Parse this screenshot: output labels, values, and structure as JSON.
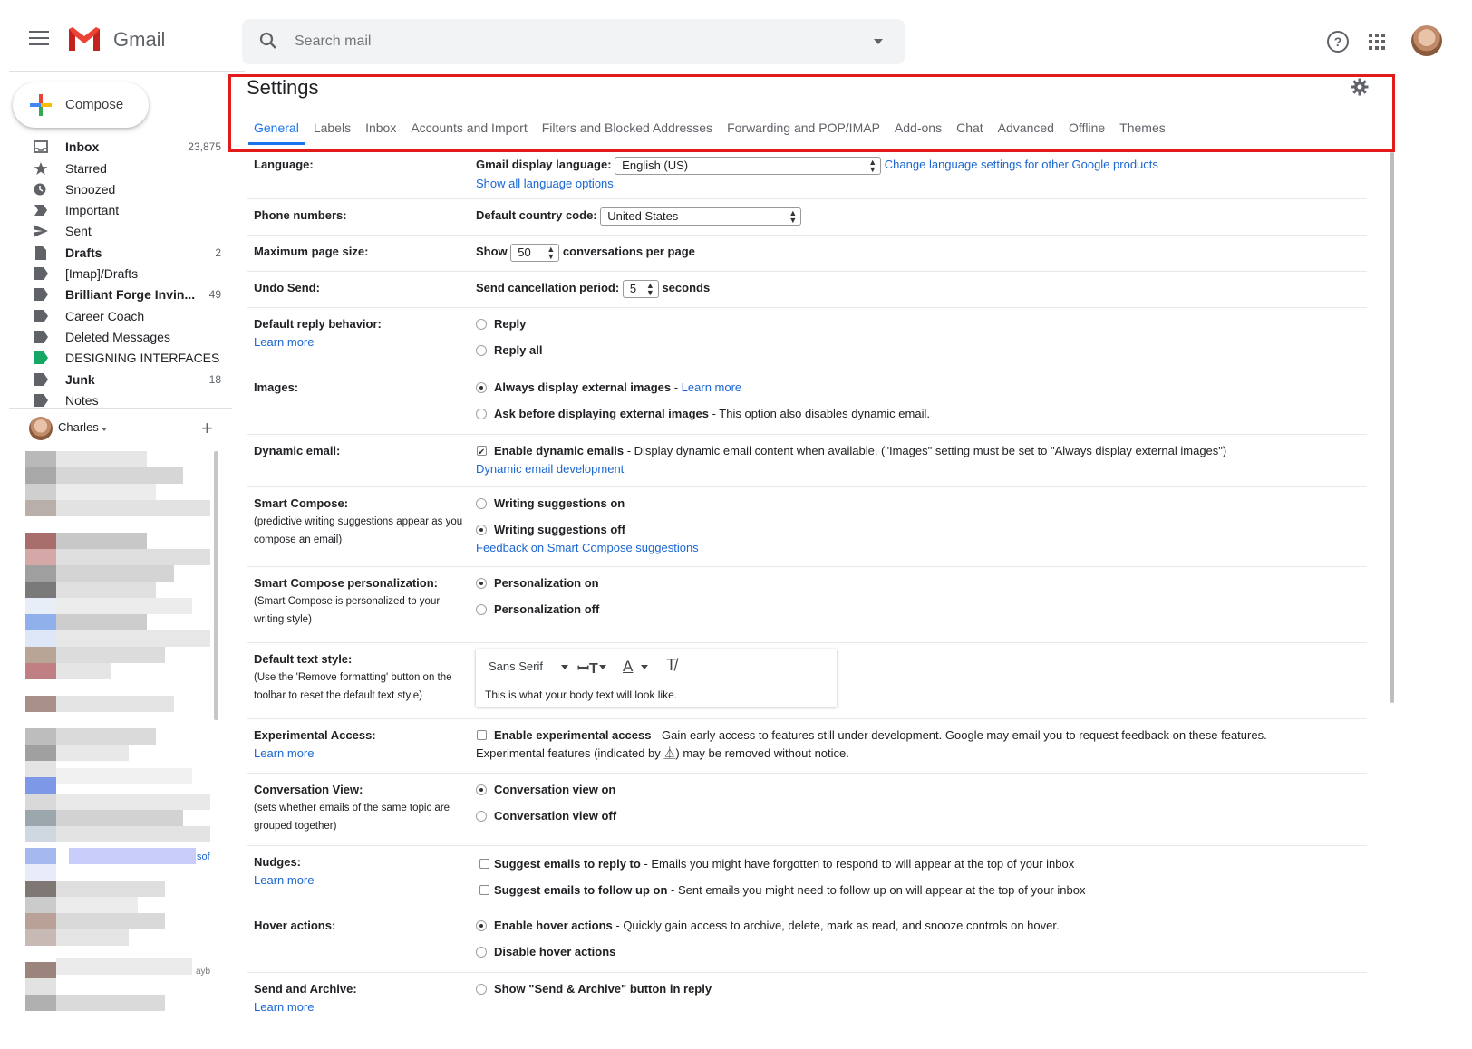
{
  "app": {
    "name": "Gmail"
  },
  "search": {
    "placeholder": "Search mail"
  },
  "compose": {
    "label": "Compose"
  },
  "nav": [
    {
      "label": "Inbox",
      "count": "23,875",
      "bold": true,
      "icon": "inbox-icon"
    },
    {
      "label": "Starred",
      "count": "",
      "bold": false,
      "icon": "star-icon"
    },
    {
      "label": "Snoozed",
      "count": "",
      "bold": false,
      "icon": "clock-icon"
    },
    {
      "label": "Important",
      "count": "",
      "bold": false,
      "icon": "important-icon"
    },
    {
      "label": "Sent",
      "count": "",
      "bold": false,
      "icon": "send-icon"
    },
    {
      "label": "Drafts",
      "count": "2",
      "bold": true,
      "icon": "draft-icon"
    },
    {
      "label": "[Imap]/Drafts",
      "count": "",
      "bold": false,
      "icon": "label-icon"
    },
    {
      "label": "Brilliant Forge Invin...",
      "count": "49",
      "bold": true,
      "icon": "label-icon"
    },
    {
      "label": "Career Coach",
      "count": "",
      "bold": false,
      "icon": "label-icon"
    },
    {
      "label": "Deleted Messages",
      "count": "",
      "bold": false,
      "icon": "label-icon"
    },
    {
      "label": "DESIGNING INTERFACES",
      "count": "",
      "bold": false,
      "icon": "label-green-icon"
    },
    {
      "label": "Junk",
      "count": "18",
      "bold": true,
      "icon": "label-icon"
    },
    {
      "label": "Notes",
      "count": "",
      "bold": false,
      "icon": "label-icon"
    }
  ],
  "hangouts": {
    "user": "Charles"
  },
  "sidebar_fragments": {
    "frag1": "sof",
    "frag2": "ayb"
  },
  "settings": {
    "title": "Settings",
    "tabs": [
      "General",
      "Labels",
      "Inbox",
      "Accounts and Import",
      "Filters and Blocked Addresses",
      "Forwarding and POP/IMAP",
      "Add-ons",
      "Chat",
      "Advanced",
      "Offline",
      "Themes"
    ],
    "active_tab": "General",
    "language": {
      "label": "Language:",
      "field": "Gmail display language:",
      "value": "English (US)",
      "link1": "Change language settings for other Google products",
      "link2": "Show all language options"
    },
    "phone": {
      "label": "Phone numbers:",
      "field": "Default country code:",
      "value": "United States"
    },
    "page_size": {
      "label": "Maximum page size:",
      "pre": "Show",
      "value": "50",
      "post": "conversations per page"
    },
    "undo": {
      "label": "Undo Send:",
      "field": "Send cancellation period:",
      "value": "5",
      "post": "seconds"
    },
    "reply": {
      "label": "Default reply behavior:",
      "learn": "Learn more",
      "opt1": "Reply",
      "opt2": "Reply all"
    },
    "images": {
      "label": "Images:",
      "opt1": "Always display external images",
      "opt1_sep": " - ",
      "opt1_link": "Learn more",
      "opt2": "Ask before displaying external images",
      "opt2_desc": " - This option also disables dynamic email."
    },
    "dynamic": {
      "label": "Dynamic email:",
      "opt": "Enable dynamic emails",
      "desc": " - Display dynamic email content when available. (\"Images\" setting must be set to \"Always display external images\")",
      "link": "Dynamic email development"
    },
    "smart_compose": {
      "label": "Smart Compose:",
      "sub": "(predictive writing suggestions appear as you compose an email)",
      "opt1": "Writing suggestions on",
      "opt2": "Writing suggestions off",
      "link": "Feedback on Smart Compose suggestions"
    },
    "personalization": {
      "label": "Smart Compose personalization:",
      "sub": "(Smart Compose is personalized to your writing style)",
      "opt1": "Personalization on",
      "opt2": "Personalization off"
    },
    "text_style": {
      "label": "Default text style:",
      "sub": "(Use the 'Remove formatting' button on the toolbar to reset the default text style)",
      "font": "Sans Serif",
      "sample": "This is what your body text will look like."
    },
    "experimental": {
      "label": "Experimental Access:",
      "learn": "Learn more",
      "opt": "Enable experimental access",
      "desc": " - Gain early access to features still under development. Google may email you to request feedback on these features.",
      "desc2a": "Experimental features (indicated by ",
      "desc2b": ") may be removed without notice."
    },
    "conversation": {
      "label": "Conversation View:",
      "sub": "(sets whether emails of the same topic are grouped together)",
      "opt1": "Conversation view on",
      "opt2": "Conversation view off"
    },
    "nudges": {
      "label": "Nudges:",
      "learn": "Learn more",
      "opt1": "Suggest emails to reply to",
      "opt1_desc": " - Emails you might have forgotten to respond to will appear at the top of your inbox",
      "opt2": "Suggest emails to follow up on",
      "opt2_desc": " - Sent emails you might need to follow up on will appear at the top of your inbox"
    },
    "hover": {
      "label": "Hover actions:",
      "opt1": "Enable hover actions",
      "opt1_desc": " - Quickly gain access to archive, delete, mark as read, and snooze controls on hover.",
      "opt2": "Disable hover actions"
    },
    "send_archive": {
      "label": "Send and Archive:",
      "learn": "Learn more",
      "opt1": "Show \"Send & Archive\" button in reply"
    }
  },
  "colors": {
    "highlight_box": "#e21a1a",
    "link": "#1a66d2",
    "active_tab": "#1a73e8",
    "label_green": "#16a765"
  }
}
